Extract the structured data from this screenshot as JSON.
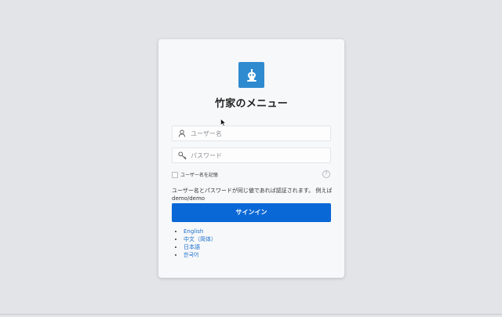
{
  "login": {
    "title": "竹家のメニュー",
    "username_placeholder": "ユーザー名",
    "password_placeholder": "パスワード",
    "remember_label": "ユーザー名を記憶",
    "hint": "ユーザー名とパスワードが同じ値であれば認証されます。 例えば demo/demo",
    "signin_label": "サインイン",
    "help_glyph": "?"
  },
  "languages": [
    "English",
    "中文（简体）",
    "日本語",
    "한국어"
  ],
  "colors": {
    "background": "#e3e4e8",
    "card": "#f7f8f9",
    "logo": "#2f8bd0",
    "button": "#0a68d6",
    "link": "#1a6fd0"
  },
  "icons": {
    "logo": "robot-icon",
    "username": "user-icon",
    "password": "key-icon",
    "help": "help-icon"
  }
}
